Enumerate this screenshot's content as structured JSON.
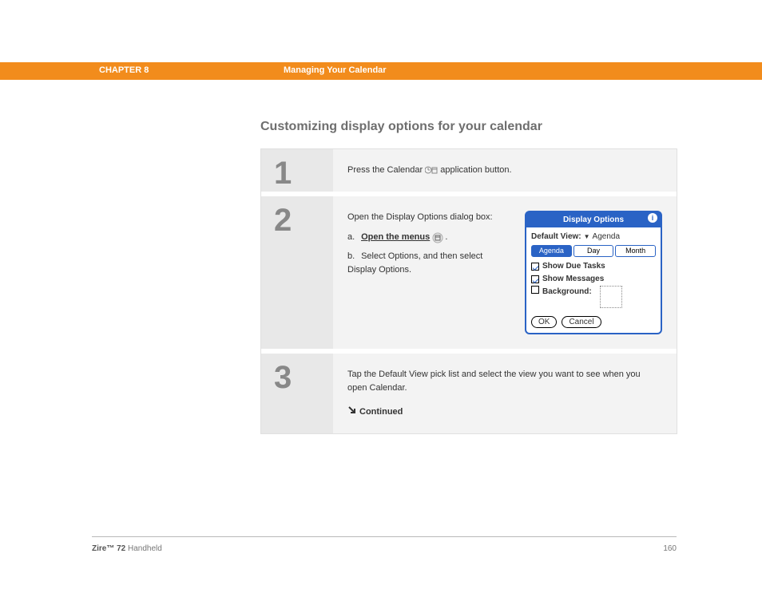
{
  "header": {
    "chapter": "CHAPTER 8",
    "section": "Managing Your Calendar"
  },
  "heading": "Customizing display options for your calendar",
  "steps": [
    {
      "num": "1",
      "text_before": "Press the Calendar ",
      "text_after": " application button."
    },
    {
      "num": "2",
      "intro": "Open the Display Options dialog box:",
      "a_label": "a.",
      "a_link": "Open the menus",
      "a_after": ".",
      "b_label": "b.",
      "b_text": "Select Options, and then select Display Options."
    },
    {
      "num": "3",
      "text": "Tap the Default View pick list and select the view you want to see when you open Calendar.",
      "continued": "Continued"
    }
  ],
  "dialog": {
    "title": "Display Options",
    "default_view_label": "Default View:",
    "default_view_value": "Agenda",
    "tabs": [
      "Agenda",
      "Day",
      "Month"
    ],
    "active_tab": 0,
    "checks": [
      {
        "label": "Show Due Tasks",
        "checked": true
      },
      {
        "label": "Show Messages",
        "checked": true
      }
    ],
    "background_label": "Background:",
    "buttons": {
      "ok": "OK",
      "cancel": "Cancel"
    }
  },
  "footer": {
    "product_bold": "Zire™ 72",
    "product_rest": " Handheld",
    "page": "160"
  }
}
